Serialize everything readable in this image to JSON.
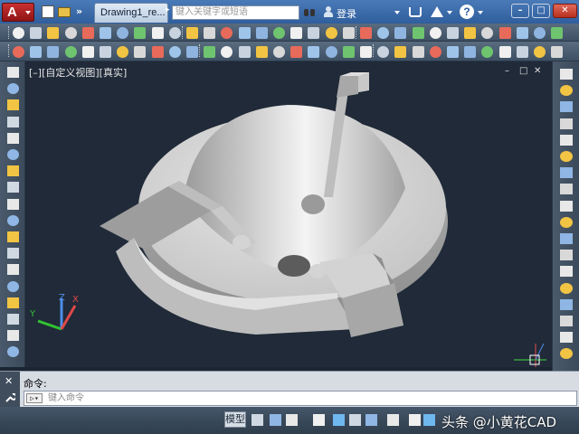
{
  "titlebar": {
    "app_letter": "A",
    "document_tab": "Drawing1_re...",
    "search_placeholder": "键入关键字或短语",
    "login_label": "登录",
    "help_glyph": "?",
    "minimize_glyph": "–",
    "maximize_glyph": "□",
    "close_glyph": "✕"
  },
  "viewport": {
    "label": "[–][自定义视图][真实]",
    "controls": [
      "–",
      "□",
      "✕"
    ],
    "ucs": {
      "x": "X",
      "y": "Y",
      "z": "Z"
    }
  },
  "command": {
    "history_label": "命令:",
    "close_glyph": "✕",
    "prompt_glyph": "▷▾",
    "input_placeholder": "键入命令"
  },
  "statusbar": {
    "model_tab": "模型",
    "watermark": "头条 @小黄花CAD"
  },
  "colors": {
    "viewport_bg": "#202a38",
    "toolbar_bg": "#4b5d71",
    "accent_red": "#c93030",
    "model_light": "#e2e2e2",
    "model_dark": "#8c8c8c"
  }
}
